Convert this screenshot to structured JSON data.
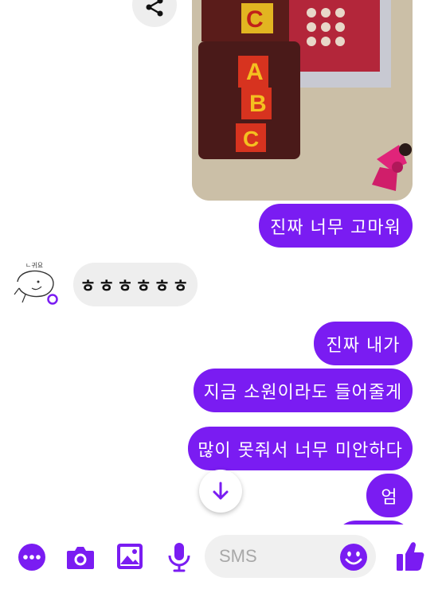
{
  "photo": {
    "label": "shared photo of ABC chocolate packages"
  },
  "messages": {
    "outgoing_1": "진짜 너무 고마워",
    "incoming_1": "ㅎㅎㅎㅎㅎㅎ",
    "outgoing_2": "진짜 내가",
    "outgoing_3": "지금 소원이라도 들어줄게",
    "outgoing_4": "많이 못줘서 너무 미안하다",
    "outgoing_5": "엄"
  },
  "composer": {
    "placeholder": "SMS"
  },
  "icons": {
    "share": "share-icon",
    "more": "more-icon",
    "camera": "camera-icon",
    "gallery": "image-icon",
    "mic": "mic-icon",
    "emoji": "emoji-icon",
    "like": "thumbs-up-icon",
    "scroll": "arrow-down-icon"
  },
  "colors": {
    "accent": "#7a1cf2",
    "incoming_bubble": "#eeeeee"
  }
}
